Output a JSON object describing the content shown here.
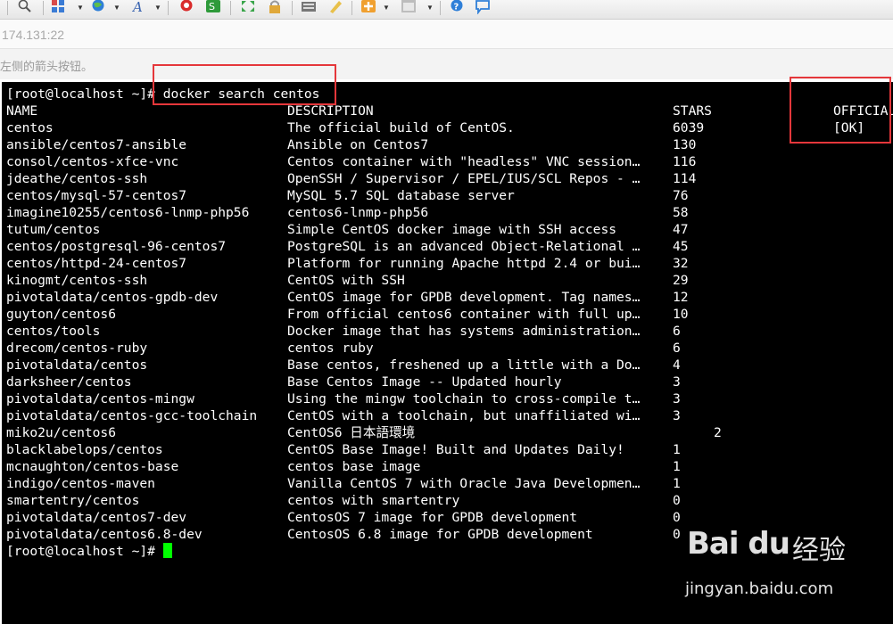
{
  "address": "174.131:22",
  "hint": "左侧的箭头按钮。",
  "terminal": {
    "command_prompt": "[root@localhost ~]# docker search centos",
    "headers": {
      "name": "NAME",
      "description": "DESCRIPTION",
      "stars": "STARS",
      "official": "OFFICIAL"
    },
    "rows": [
      {
        "name": "centos",
        "description": "The official build of CentOS.",
        "stars": "6039",
        "official": "[OK]"
      },
      {
        "name": "ansible/centos7-ansible",
        "description": "Ansible on Centos7",
        "stars": "130",
        "official": ""
      },
      {
        "name": "consol/centos-xfce-vnc",
        "description": "Centos container with \"headless\" VNC session…",
        "stars": "116",
        "official": ""
      },
      {
        "name": "jdeathe/centos-ssh",
        "description": "OpenSSH / Supervisor / EPEL/IUS/SCL Repos - …",
        "stars": "114",
        "official": ""
      },
      {
        "name": "centos/mysql-57-centos7",
        "description": "MySQL 5.7 SQL database server",
        "stars": "76",
        "official": ""
      },
      {
        "name": "imagine10255/centos6-lnmp-php56",
        "description": "centos6-lnmp-php56",
        "stars": "58",
        "official": ""
      },
      {
        "name": "tutum/centos",
        "description": "Simple CentOS docker image with SSH access",
        "stars": "47",
        "official": ""
      },
      {
        "name": "centos/postgresql-96-centos7",
        "description": "PostgreSQL is an advanced Object-Relational …",
        "stars": "45",
        "official": ""
      },
      {
        "name": "centos/httpd-24-centos7",
        "description": "Platform for running Apache httpd 2.4 or bui…",
        "stars": "32",
        "official": ""
      },
      {
        "name": "kinogmt/centos-ssh",
        "description": "CentOS with SSH",
        "stars": "29",
        "official": ""
      },
      {
        "name": "pivotaldata/centos-gpdb-dev",
        "description": "CentOS image for GPDB development. Tag names…",
        "stars": "12",
        "official": ""
      },
      {
        "name": "guyton/centos6",
        "description": "From official centos6 container with full up…",
        "stars": "10",
        "official": ""
      },
      {
        "name": "centos/tools",
        "description": "Docker image that has systems administration…",
        "stars": "6",
        "official": ""
      },
      {
        "name": "drecom/centos-ruby",
        "description": "centos ruby",
        "stars": "6",
        "official": ""
      },
      {
        "name": "pivotaldata/centos",
        "description": "Base centos, freshened up a little with a Do…",
        "stars": "4",
        "official": ""
      },
      {
        "name": "darksheer/centos",
        "description": "Base Centos Image -- Updated hourly",
        "stars": "3",
        "official": ""
      },
      {
        "name": "pivotaldata/centos-mingw",
        "description": "Using the mingw toolchain to cross-compile t…",
        "stars": "3",
        "official": ""
      },
      {
        "name": "pivotaldata/centos-gcc-toolchain",
        "description": "CentOS with a toolchain, but unaffiliated wi…",
        "stars": "3",
        "official": ""
      },
      {
        "name": "miko2u/centos6",
        "description": "CentOS6 日本語環境",
        "stars": "2",
        "official": "",
        "stars_offset": true
      },
      {
        "name": "blacklabelops/centos",
        "description": "CentOS Base Image! Built and Updates Daily!",
        "stars": "1",
        "official": ""
      },
      {
        "name": "mcnaughton/centos-base",
        "description": "centos base image",
        "stars": "1",
        "official": ""
      },
      {
        "name": "indigo/centos-maven",
        "description": "Vanilla CentOS 7 with Oracle Java Developmen…",
        "stars": "1",
        "official": ""
      },
      {
        "name": "smartentry/centos",
        "description": "centos with smartentry",
        "stars": "0",
        "official": ""
      },
      {
        "name": "pivotaldata/centos7-dev",
        "description": "CentosOS 7 image for GPDB development",
        "stars": "0",
        "official": ""
      },
      {
        "name": "pivotaldata/centos6.8-dev",
        "description": "CentosOS 6.8 image for GPDB development",
        "stars": "0",
        "official": ""
      }
    ],
    "final_prompt": "[root@localhost ~]# "
  },
  "watermark": {
    "logo": "Bai du",
    "cn": "经验",
    "url": "jingyan.baidu.com"
  },
  "colors": {
    "highlight": "#e5373b",
    "cursor": "#00ff00",
    "terminal_bg": "#000000"
  }
}
